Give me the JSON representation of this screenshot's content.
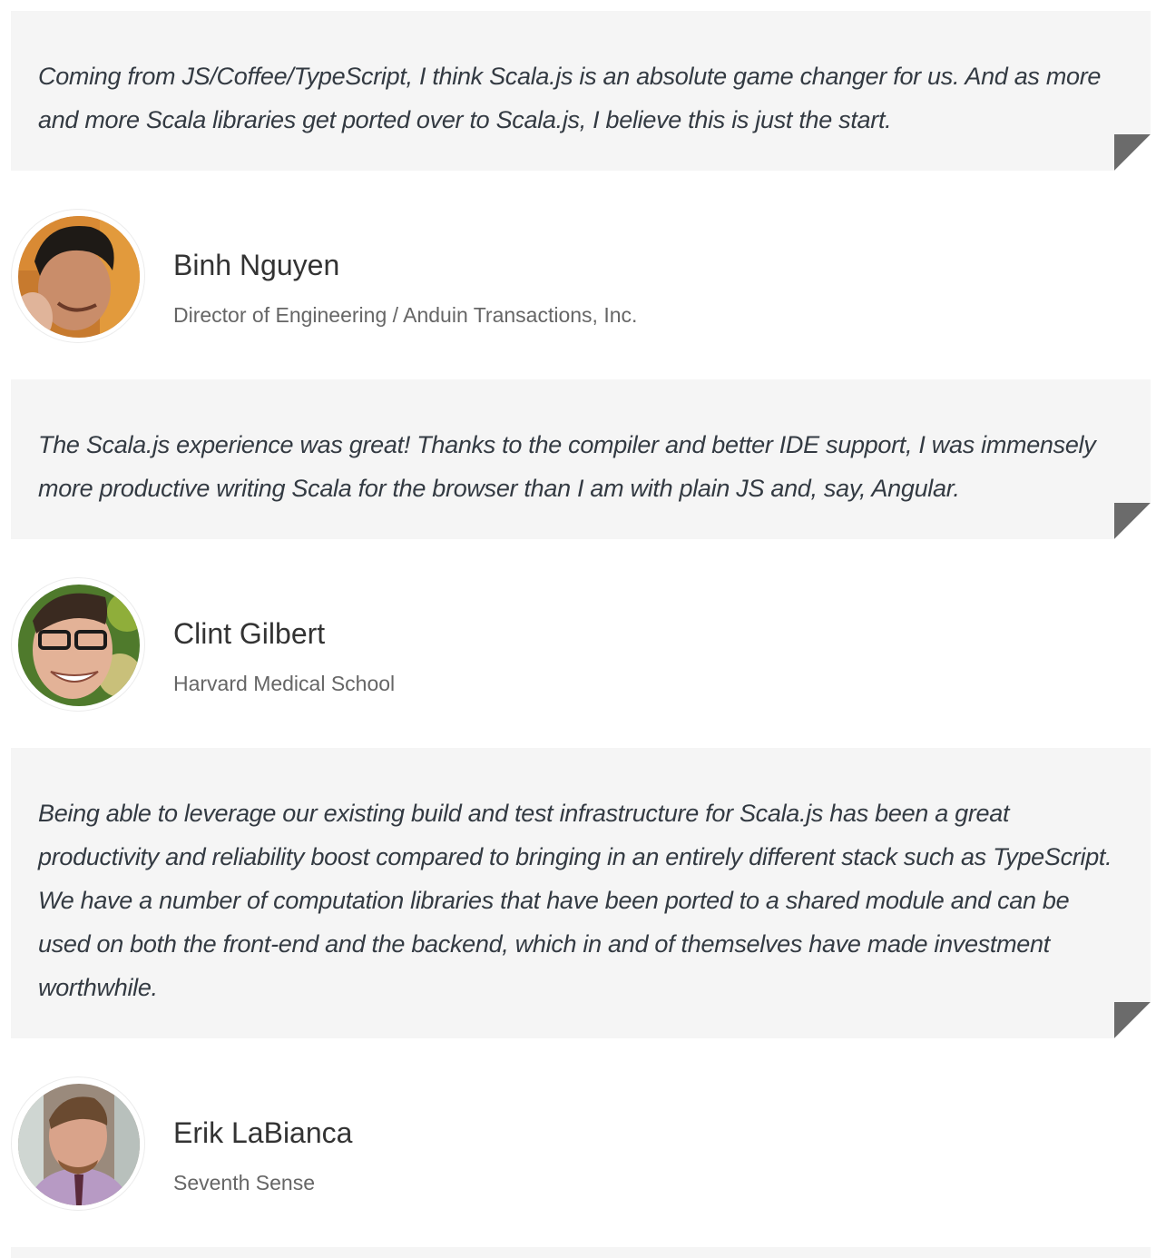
{
  "testimonials": [
    {
      "quote": "Coming from JS/Coffee/TypeScript, I think Scala.js is an absolute game changer for us. And as more and more Scala libraries get ported over to Scala.js, I believe this is just the start.",
      "name": "Binh Nguyen",
      "role": "Director of Engineering / Anduin Transactions, Inc."
    },
    {
      "quote": "The Scala.js experience was great! Thanks to the compiler and better IDE support, I was immensely more productive writing Scala for the browser than I am with plain JS and, say, Angular.",
      "name": "Clint Gilbert",
      "role": "Harvard Medical School"
    },
    {
      "quote": "Being able to leverage our existing build and test infrastructure for Scala.js has been a great productivity and reliability boost compared to bringing in an entirely different stack such as TypeScript. We have a number of computation libraries that have been ported to a shared module and can be used on both the front-end and the backend, which in and of themselves have made investment worthwhile.",
      "name": "Erik LaBianca",
      "role": "Seventh Sense"
    }
  ],
  "colors": {
    "quote_background": "#f5f5f5",
    "quote_text": "#333a42",
    "fold_corner": "#6b6b6b",
    "name_text": "#333333",
    "role_text": "#666666"
  }
}
